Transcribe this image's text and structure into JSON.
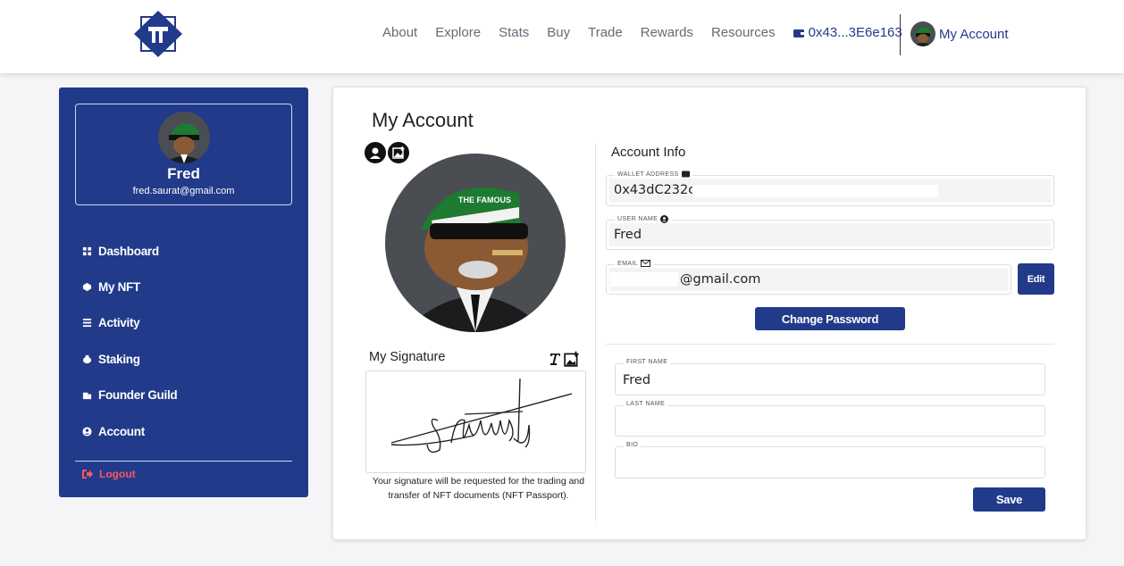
{
  "header": {
    "nav": [
      "About",
      "Explore",
      "Stats",
      "Buy",
      "Trade",
      "Rewards",
      "Resources"
    ],
    "wallet_short": "0x43...3E6e163",
    "account_label": "My Account"
  },
  "sidebar": {
    "user_name": "Fred",
    "user_email": "fred.saurat@gmail.com",
    "items": [
      {
        "label": "Dashboard",
        "icon": "dashboard-icon"
      },
      {
        "label": "My NFT",
        "icon": "nft-icon"
      },
      {
        "label": "Activity",
        "icon": "activity-icon"
      },
      {
        "label": "Staking",
        "icon": "staking-icon"
      },
      {
        "label": "Founder Guild",
        "icon": "guild-icon"
      },
      {
        "label": "Account",
        "icon": "user-icon"
      }
    ],
    "logout_label": "Logout"
  },
  "main": {
    "title": "My Account",
    "avatar_badge_text": "THE FAMOUS",
    "signature_title": "My Signature",
    "signature_note": "Your signature will be requested for the trading and transfer of NFT documents (NFT Passport).",
    "account_info_title": "Account Info",
    "wallet_label": "WALLET ADDRESS",
    "wallet_value": "0x43dC232c",
    "username_label": "USER NAME",
    "username_value": "Fred",
    "email_label": "EMAIL",
    "email_value": "@gmail.com",
    "edit_label": "Edit",
    "change_password_label": "Change Password",
    "first_name_label": "FIRST NAME",
    "first_name_value": "Fred",
    "last_name_label": "LAST NAME",
    "last_name_value": "",
    "bio_label": "BIO",
    "bio_value": "",
    "save_label": "Save"
  },
  "colors": {
    "brand": "#223a8a",
    "logout": "#ff5563"
  }
}
